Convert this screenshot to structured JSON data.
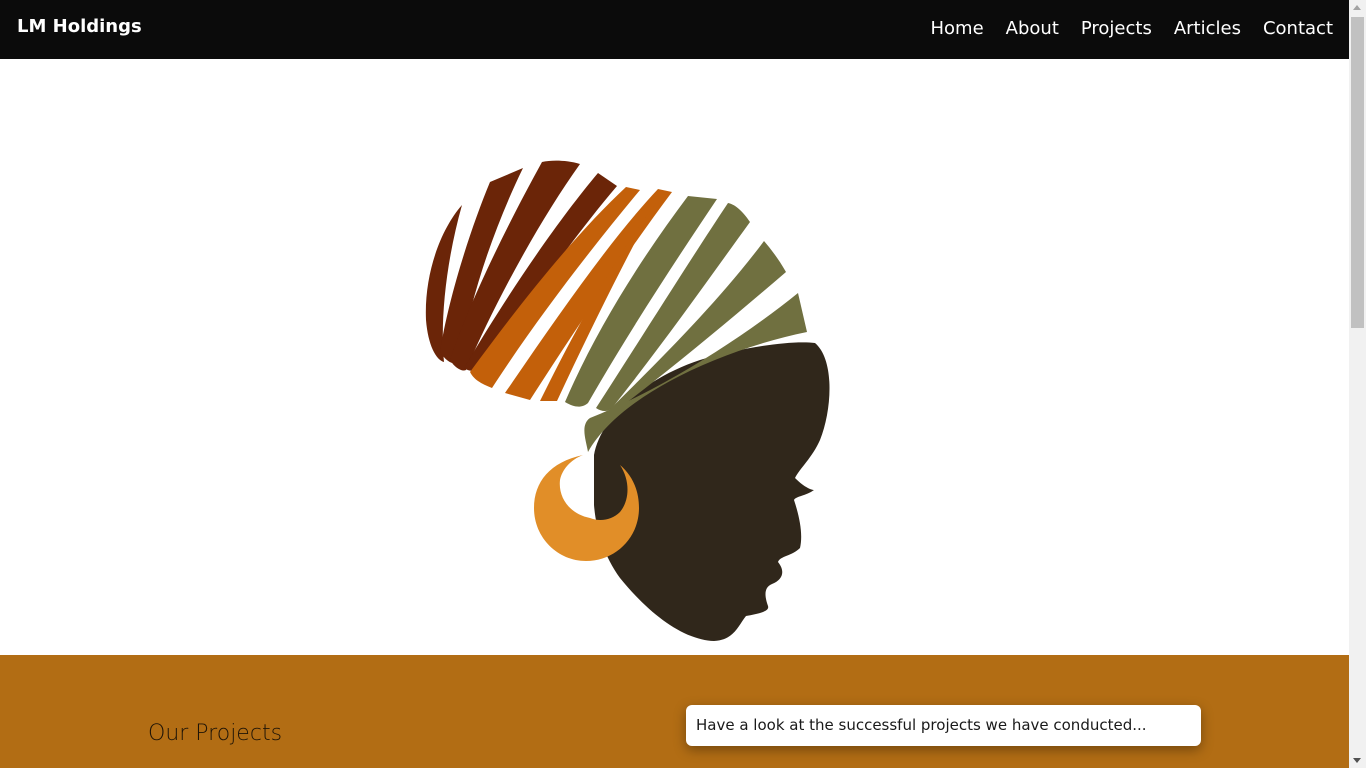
{
  "navbar": {
    "brand": "LM Holdings",
    "links": [
      {
        "label": "Home"
      },
      {
        "label": "About"
      },
      {
        "label": "Projects"
      },
      {
        "label": "Articles"
      },
      {
        "label": "Contact"
      }
    ]
  },
  "hero": {
    "illustration": "african-woman-headwrap-silhouette",
    "colors": {
      "wrap_dark_red": "#6b2508",
      "wrap_orange": "#c3600a",
      "wrap_olive": "#707040",
      "skin": "#30271b",
      "earring": "#e18e28"
    }
  },
  "projects": {
    "title": "Our Projects",
    "description": "Have a look at the successful projects we have conducted...",
    "background_color": "#b26d14"
  },
  "colors": {
    "navbar_bg": "#0b0b0b",
    "page_bg": "#ffffff"
  }
}
